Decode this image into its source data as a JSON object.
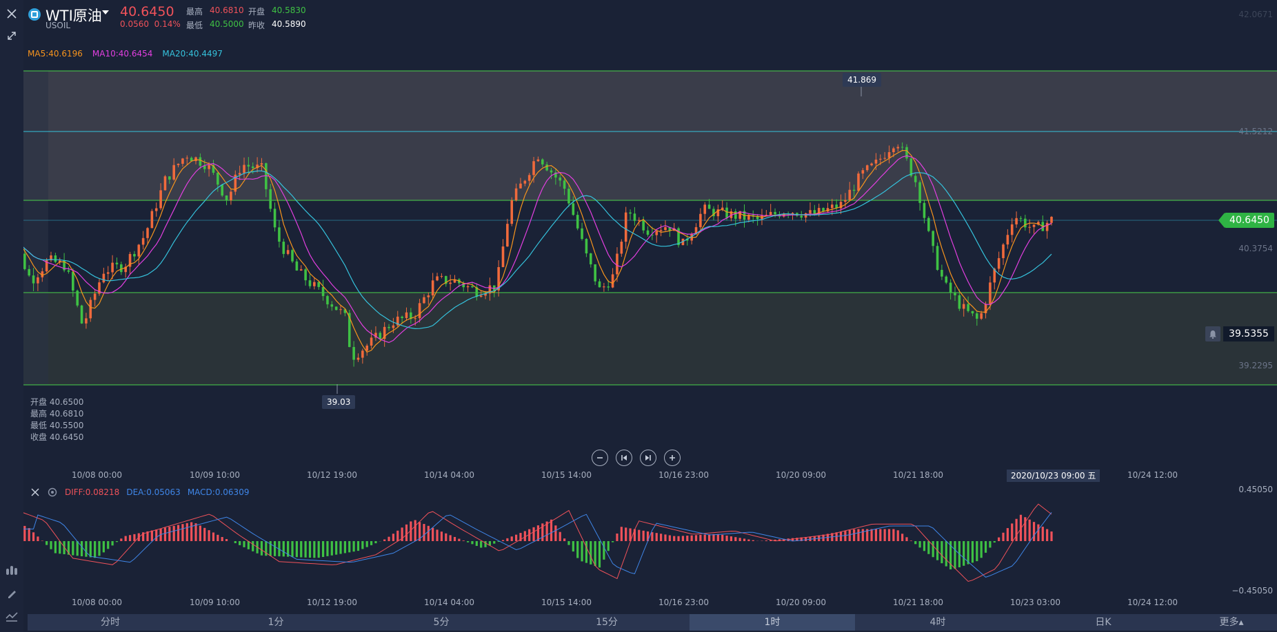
{
  "header": {
    "name": "WTI原油",
    "symbol": "USOIL",
    "price": "40.6450",
    "change": "0.0560",
    "change_pct": "0.14%",
    "high_label": "最高",
    "high": "40.6810",
    "low_label": "最低",
    "low": "40.5000",
    "open_label": "开盘",
    "open": "40.5830",
    "prev_label": "昨收",
    "prev_close": "40.5890"
  },
  "ma": {
    "ma5": "MA5:40.6196",
    "ma10": "MA10:40.6454",
    "ma20": "MA20:40.4497"
  },
  "price_axis": {
    "top": "42.0671",
    "band_top": "41.5212",
    "mid": "40.3754",
    "low": "39.2295",
    "current": "40.6450",
    "alert": "39.5355"
  },
  "extremes": {
    "high": "41.869",
    "low": "39.03"
  },
  "ohlc": {
    "open": "开盘 40.6500",
    "high": "最高 40.6810",
    "low": "最低 40.5500",
    "close": "收盘 40.6450"
  },
  "time_axis": [
    "10/08 00:00",
    "10/09 10:00",
    "10/12 19:00",
    "10/14 04:00",
    "10/15 14:00",
    "10/16 23:00",
    "10/20 09:00",
    "10/21 18:00",
    "10/24 12:00"
  ],
  "time_axis_bottom": [
    "10/08 00:00",
    "10/09 10:00",
    "10/12 19:00",
    "10/14 04:00",
    "10/15 14:00",
    "10/16 23:00",
    "10/20 09:00",
    "10/21 18:00",
    "10/23 03:00",
    "10/24 12:00"
  ],
  "time_cursor": "2020/10/23 09:00 五",
  "macd": {
    "diff": "DIFF:0.08218",
    "dea": "DEA:0.05063",
    "macd": "MACD:0.06309",
    "axis_top": "0.45050",
    "axis_bottom": "−0.45050"
  },
  "periods": [
    "分时",
    "1分",
    "5分",
    "15分",
    "1时",
    "4时",
    "日K",
    "更多▴"
  ],
  "active_period": "1时",
  "colors": {
    "up": "#f06a3c",
    "down": "#3fc144",
    "ma5": "#f7941d",
    "ma10": "#e23fe0",
    "ma20": "#35c2dc",
    "dea": "#3f86e8",
    "diff": "#f0525a"
  }
}
